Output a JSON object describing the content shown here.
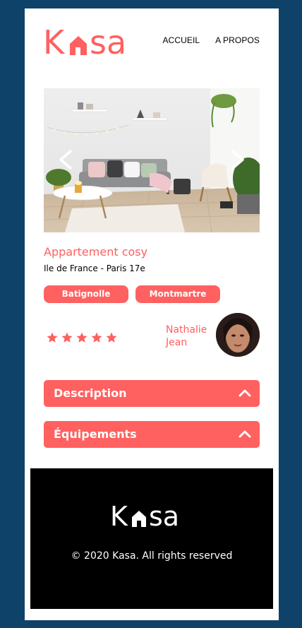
{
  "brand": {
    "logo_left": "K",
    "logo_right": "sa",
    "accent_color": "#ff6060"
  },
  "nav": {
    "home_label": "ACCUEIL",
    "about_label": "A PROPOS"
  },
  "carousel": {
    "image_description": "living-room-photo",
    "prev_icon": "chevron-left-icon",
    "next_icon": "chevron-right-icon"
  },
  "listing": {
    "title": "Appartement cosy",
    "location": "Ile de France - Paris 17e",
    "tags": [
      "Batignolle",
      "Montmartre"
    ],
    "rating": 5,
    "rating_max": 5
  },
  "host": {
    "first_name": "Nathalie",
    "last_name": "Jean"
  },
  "collapses": {
    "description_label": "Description",
    "equipments_label": "Équipements"
  },
  "footer": {
    "logo_left": "K",
    "logo_right": "sa",
    "copyright": "© 2020 Kasa. All rights reserved"
  }
}
